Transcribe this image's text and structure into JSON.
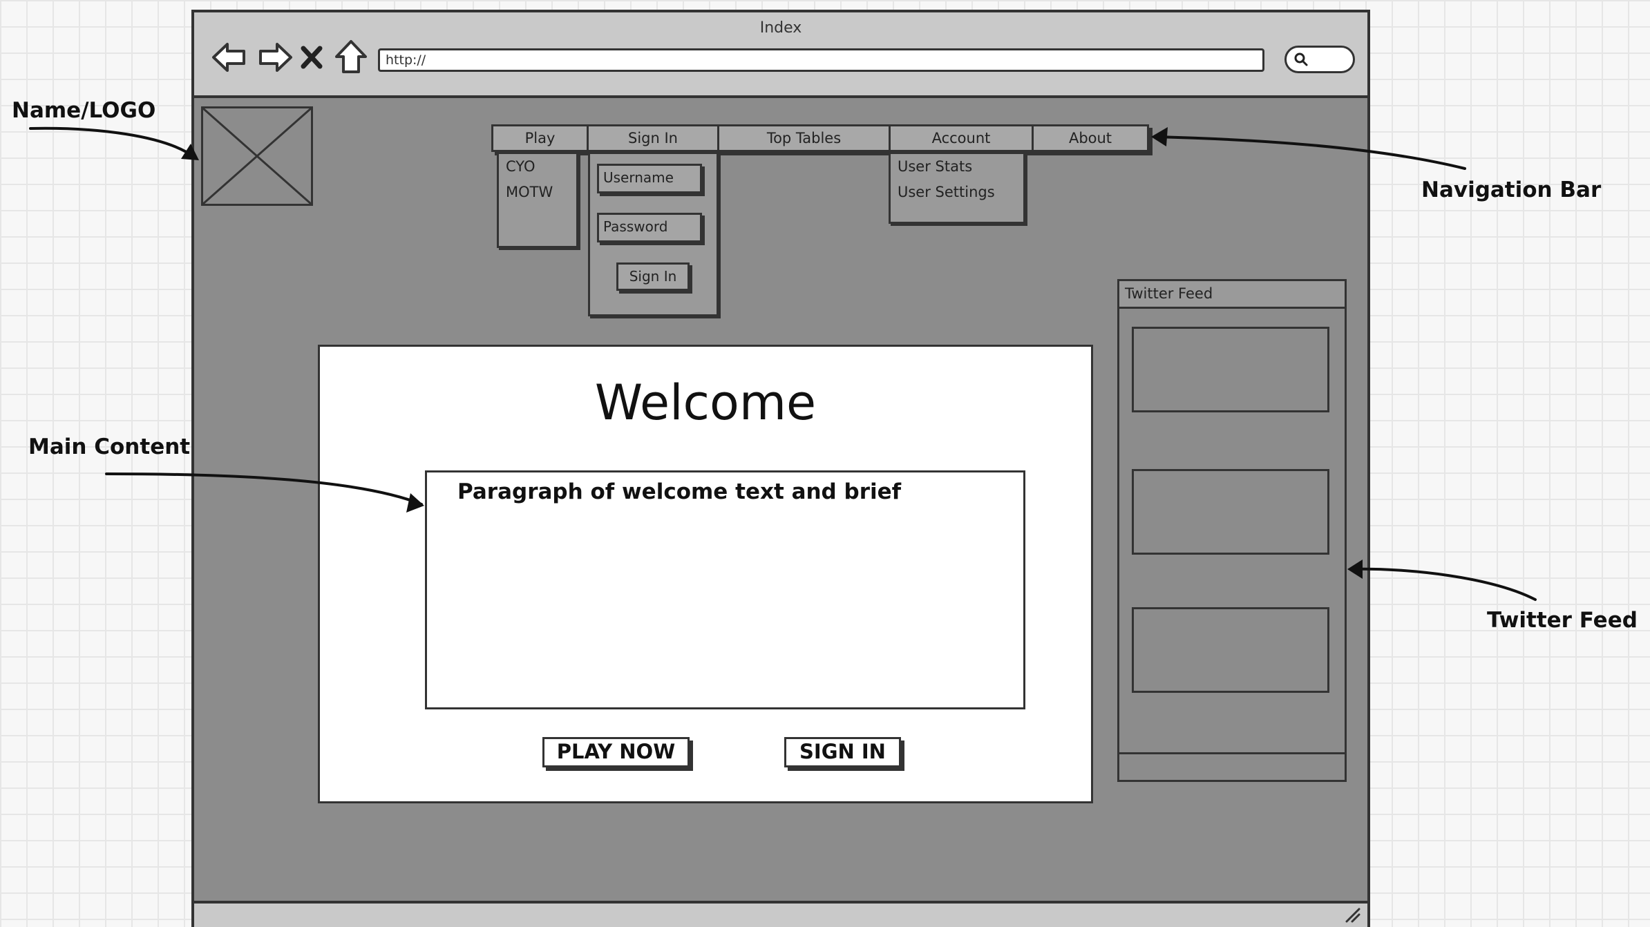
{
  "browser": {
    "title": "Index",
    "url": "http://",
    "nav_icons": [
      "back-arrow-icon",
      "forward-arrow-icon",
      "close-icon",
      "home-icon"
    ]
  },
  "nav": {
    "items": [
      {
        "label": "Play"
      },
      {
        "label": "Sign In"
      },
      {
        "label": "Top Tables"
      },
      {
        "label": "Account"
      },
      {
        "label": "About"
      }
    ]
  },
  "play_menu": {
    "items": [
      "CYO",
      "MOTW"
    ]
  },
  "signin_menu": {
    "username": "Username",
    "password": "Password",
    "button": "Sign In"
  },
  "account_menu": {
    "items": [
      "User Stats",
      "User Settings"
    ]
  },
  "main": {
    "title": "Welcome",
    "paragraph": "Paragraph of welcome text and brief",
    "play_button": "PLAY NOW",
    "signin_button": "SIGN IN"
  },
  "twitter": {
    "header": "Twitter Feed"
  },
  "callouts": {
    "logo": "Name/LOGO",
    "nav": "Navigation Bar",
    "main": "Main Content",
    "twitter": "Twitter Feed"
  },
  "colors": {
    "frame": "#8c8c8c",
    "toolbar": "#c9c9c9",
    "ink": "#333333",
    "content": "#ffffff"
  }
}
